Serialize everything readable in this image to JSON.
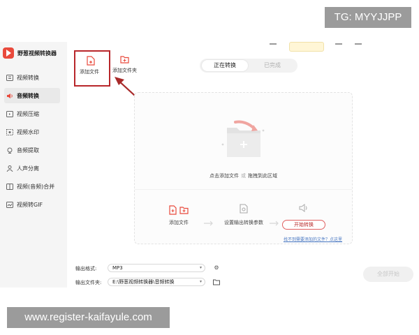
{
  "watermarks": {
    "top": "TG: MYYJJPP",
    "bottom": "www.register-kaifayule.com"
  },
  "app": {
    "title": "野葱视频转换器",
    "accent": "#e94a3c",
    "highlight_box_color": "#b8262a"
  },
  "sidebar": {
    "items": [
      {
        "label": "视频转换",
        "icon": "video-convert-icon",
        "active": false
      },
      {
        "label": "音频转换",
        "icon": "audio-icon",
        "active": true
      },
      {
        "label": "视频压缩",
        "icon": "compress-icon",
        "active": false
      },
      {
        "label": "视频水印",
        "icon": "watermark-icon",
        "active": false
      },
      {
        "label": "音频提取",
        "icon": "extract-icon",
        "active": false
      },
      {
        "label": "人声分离",
        "icon": "person-icon",
        "active": false
      },
      {
        "label": "视频(音频)合并",
        "icon": "merge-icon",
        "active": false
      },
      {
        "label": "视频转GIF",
        "icon": "gif-icon",
        "active": false
      }
    ]
  },
  "toolbar": {
    "add_file": "添加文件",
    "add_folder": "添加文件夹"
  },
  "tabs": {
    "active": "正在转换",
    "inactive": "已完成"
  },
  "dropzone": {
    "hint_left": "点击添加文件",
    "hint_or": "或",
    "hint_right": "拖拽到此区域"
  },
  "steps": {
    "add_file": "添加文件",
    "set_params": "设置输出转换参数",
    "start": "开始转换"
  },
  "help_link": "找不到需要添加的文件？点这里",
  "output": {
    "format_label": "输出格式:",
    "format_value": "MP3",
    "folder_label": "输出文件夹:",
    "folder_value": "E:\\野葱视频转换器\\音频转换"
  },
  "start_all": "全部开始"
}
